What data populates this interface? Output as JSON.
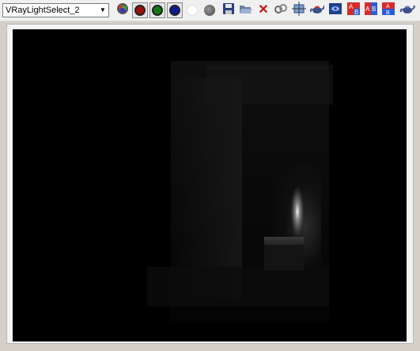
{
  "toolbar": {
    "channel_select": {
      "value": "VRayLightSelect_2"
    },
    "buttons": [
      {
        "name": "rgb-channels-icon"
      },
      {
        "name": "red-channel-icon",
        "color": "#9b1010"
      },
      {
        "name": "green-channel-icon",
        "color": "#0f7a12"
      },
      {
        "name": "blue-channel-icon",
        "color": "#0d1a9a"
      },
      {
        "name": "alpha-channel-icon",
        "color": "#ffffff"
      },
      {
        "name": "mono-channel-icon",
        "color": "#6b6b6b"
      },
      {
        "name": "save-icon"
      },
      {
        "name": "open-icon"
      },
      {
        "name": "clear-icon"
      },
      {
        "name": "link-icon"
      },
      {
        "name": "region-render-icon"
      },
      {
        "name": "teapot-render-icon"
      },
      {
        "name": "display-icon"
      },
      {
        "name": "ab-compare-a-icon"
      },
      {
        "name": "ab-compare-b-icon"
      },
      {
        "name": "ab-compare-vertical-icon"
      },
      {
        "name": "teapot-render-last-icon"
      }
    ]
  },
  "viewport": {
    "description_colors": {
      "background": "#000000",
      "frame": "#f4f4f4"
    }
  }
}
